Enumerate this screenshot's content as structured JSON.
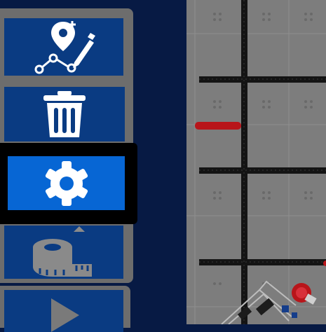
{
  "sidebar": {
    "tools": [
      {
        "name": "add-waypoint-path",
        "icon": "path-edit-icon",
        "active": false
      },
      {
        "name": "delete",
        "icon": "trash-icon",
        "active": false
      },
      {
        "name": "settings",
        "icon": "gear-icon",
        "active": true
      },
      {
        "name": "measure",
        "icon": "tape-measure-icon",
        "active": false
      },
      {
        "name": "run",
        "icon": "play-icon",
        "active": false
      }
    ]
  },
  "field": {
    "tile_color": "#7d7d7d",
    "tape_color": "#141414",
    "marker_color": "#b8151a"
  },
  "colors": {
    "background": "#071a44",
    "button": "#0a3b82",
    "button_active": "#0766d4",
    "panel": "#6d6d6d"
  }
}
